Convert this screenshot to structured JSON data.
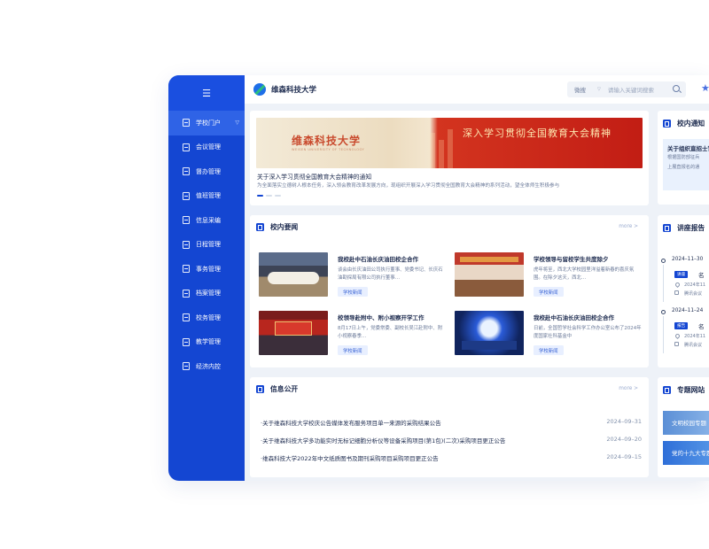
{
  "app": {
    "name": "维森科技大学"
  },
  "search": {
    "scope": "微搜",
    "placeholder": "请输入关键词搜索"
  },
  "sidebar": {
    "items": [
      {
        "label": "学校门户",
        "active": true
      },
      {
        "label": "会议管理"
      },
      {
        "label": "督办管理"
      },
      {
        "label": "值班管理"
      },
      {
        "label": "信息采编"
      },
      {
        "label": "日程管理"
      },
      {
        "label": "事务管理"
      },
      {
        "label": "档案管理"
      },
      {
        "label": "校务管理"
      },
      {
        "label": "教学管理"
      },
      {
        "label": "经济内控"
      }
    ]
  },
  "banner": {
    "school_cn": "维森科技大学",
    "school_en": "WEISEN UNIVERSITY OF TECHNOLOGY",
    "slogan": "深入学习贯彻全国教育大会精神",
    "title": "关于深入学习贯彻全国教育大会精神的通知",
    "desc": "为全面落实立德树人根本任务，深入领会教育改革发展方向，现组织开展深入学习贯彻全国教育大会精神的系列活动，望全体师生积极参与"
  },
  "news": {
    "title": "校内要闻",
    "more": "more >",
    "items": [
      {
        "title": "我校赴中石油长庆油田校企合作",
        "desc": "谈会由长庆油田公司执行董事、党委书记、长庆石油勘探局有限公司执行董事…",
        "tag": "学校新闻"
      },
      {
        "title": "学校领导与留校学生共度除夕",
        "desc": "虎年将至，西北大学校园里洋溢着新春的喜庆氛围。在除夕这天，西北…",
        "tag": "学校新闻"
      },
      {
        "title": "校领导赴附中、附小视察开学工作",
        "desc": "8月17日上午，党委常委、副校长吴江赴附中、附小视察春季…",
        "tag": "学校新闻"
      },
      {
        "title": "我校赴中石油长庆油田校企合作",
        "desc": "日前，全国哲学社会科学工作办公室公布了2024年度国家社科基金中",
        "tag": "学校新闻"
      }
    ]
  },
  "info": {
    "title": "信息公开",
    "more": "more >",
    "rows": [
      {
        "text": "·关于维森科技大学校庆公告媒体发布服务项目单一来源的采购结果公告",
        "date": "2024–09–31"
      },
      {
        "text": "·关于维森科技大学多功能实时无标记细胞分析仪等设备采购项目(第1包)(二次)采购项目更正公告",
        "date": "2024–09–20"
      },
      {
        "text": "·维森科技大学2022年中文纸质图书及期刊采购项目采购项目更正公告",
        "date": "2024–09–15"
      }
    ]
  },
  "notice": {
    "title": "校内通知",
    "item_title": "关于组织直招士官",
    "item_desc": [
      "根据国防部征兵",
      "上展直报名的通"
    ]
  },
  "lectures": {
    "title": "讲座报告",
    "items": [
      {
        "date": "2024–11–30",
        "badge": "讲座",
        "name": "名",
        "line1": "2024年11",
        "line2": "腾讯会议"
      },
      {
        "date": "2024–11–24",
        "badge": "报告",
        "name": "名",
        "line1": "2024年11",
        "line2": "腾讯会议"
      }
    ]
  },
  "sites": {
    "title": "专题网站",
    "items": [
      {
        "label": "文明校园专题"
      },
      {
        "label": "党的十九大专题"
      }
    ]
  },
  "colors": {
    "accent": "#1446d2",
    "banner_red": "#c21d14"
  },
  "icons": {
    "menu": "menu-icon",
    "search": "search-icon",
    "star": "star-icon"
  }
}
